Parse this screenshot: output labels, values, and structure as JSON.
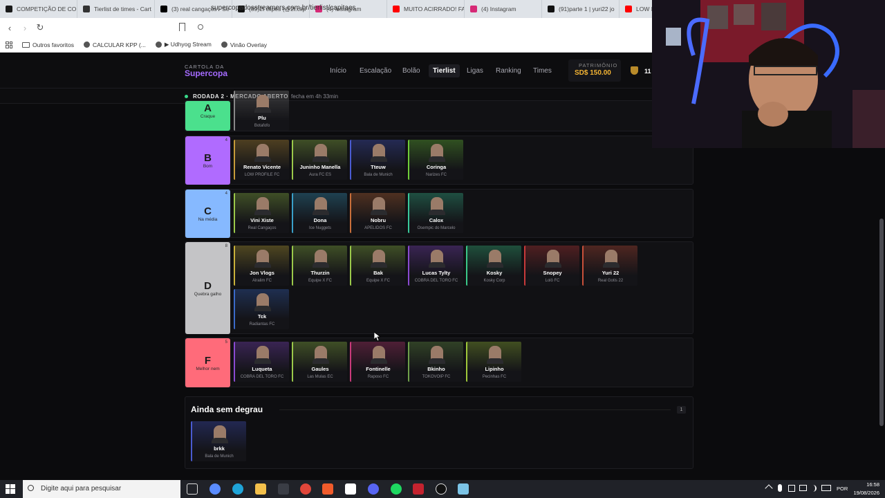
{
  "browser": {
    "tabs": [
      {
        "label": "COMPETIÇÃO DE COR",
        "color": "#1a1a1a"
      },
      {
        "label": "Tierlist de times - Cart",
        "color": "#333"
      },
      {
        "label": "(3) real cangaços - Se",
        "color": "#000"
      },
      {
        "label": "(89)2t clipes (@2t.clip",
        "color": "#111"
      },
      {
        "label": "(4) Instagram",
        "color": "#d62976"
      },
      {
        "label": "MUITO ACIRRADO! FA",
        "color": "#ff0000"
      },
      {
        "label": "(4) Instagram",
        "color": "#d62976"
      },
      {
        "label": "(91)parte 1 | yuri22 jo",
        "color": "#111"
      },
      {
        "label": "LOW P",
        "color": "#ff0000"
      }
    ],
    "url": "supercopadosstreamers.com.br/tierlist/capitaes",
    "bookmarks": [
      "Outros favoritos",
      "CALCULAR KPP (...",
      "▶ Udhyog Stream",
      "Vinão Overlay"
    ]
  },
  "site": {
    "logo_top": "CARTOLA DA",
    "logo_bottom": "Supercopa",
    "nav": [
      "Início",
      "Escalação",
      "Bolão",
      "Tierlist",
      "Ligas",
      "Ranking",
      "Times"
    ],
    "patrimonio_label": "PATRIMÔNIO",
    "patrimonio_value": "SD$ 150.00",
    "user_short": "11",
    "round_text": "RODADA 2 · MERCADO ABERTO",
    "round_close": "fecha em 4h  33min"
  },
  "tiers": [
    {
      "letter": "A",
      "desc": "Craque",
      "count": "",
      "color": "#4be08d",
      "cards": [
        {
          "name": "Plu",
          "team": "Botafofo",
          "accent": "#888888"
        }
      ]
    },
    {
      "letter": "B",
      "desc": "Bom",
      "count": "4",
      "color": "#b06bff",
      "cards": [
        {
          "name": "Renato Vicente",
          "team": "LOW PROFILE FC",
          "accent": "#c79b3a"
        },
        {
          "name": "Juninho Manella",
          "team": "Aura FC ES",
          "accent": "#9bc94a"
        },
        {
          "name": "Tteuw",
          "team": "Bala de Munich",
          "accent": "#4a5bd1"
        },
        {
          "name": "Coringa",
          "team": "Narizes FC",
          "accent": "#6fcf3a"
        }
      ]
    },
    {
      "letter": "C",
      "desc": "Na média",
      "count": "4",
      "color": "#86b9ff",
      "cards": [
        {
          "name": "Vini Xiste",
          "team": "Real Cangaços",
          "accent": "#9bc94a"
        },
        {
          "name": "Dona",
          "team": "Ice Nuggets",
          "accent": "#3aa0c9"
        },
        {
          "name": "Nobru",
          "team": "APELIDOS FC",
          "accent": "#c96f3a"
        },
        {
          "name": "Calox",
          "team": "Osempic do Marcelo",
          "accent": "#3ac99b"
        }
      ]
    },
    {
      "letter": "D",
      "desc": "Quebra galho",
      "count": "8",
      "color": "#c4c4c6",
      "cards": [
        {
          "name": "Jon Vlogs",
          "team": "Alralim FC",
          "accent": "#c9b13a"
        },
        {
          "name": "Thurzin",
          "team": "Equipe X FC",
          "accent": "#9bc94a"
        },
        {
          "name": "Bak",
          "team": "Equipe X FC",
          "accent": "#9bc94a"
        },
        {
          "name": "Lucas Tylty",
          "team": "COBRA DEL TORO FC",
          "accent": "#8a4ad1"
        },
        {
          "name": "Kosky",
          "team": "Kosky Corp",
          "accent": "#3ac98a"
        },
        {
          "name": "Snopey",
          "team": "Lolô FC",
          "accent": "#c93a3a"
        },
        {
          "name": "Yuri 22",
          "team": "Real Gotis 22",
          "accent": "#c9503a"
        },
        {
          "name": "Tck",
          "team": "Radiantas FC",
          "accent": "#3a6ac9"
        }
      ]
    },
    {
      "letter": "F",
      "desc": "Melhor nem",
      "count": "5",
      "color": "#ff6b7a",
      "cards": [
        {
          "name": "Luqueta",
          "team": "COBRA DEL TORO FC",
          "accent": "#8a4ad1"
        },
        {
          "name": "Gaules",
          "team": "Las Mulas EC",
          "accent": "#9bc94a"
        },
        {
          "name": "Fontinelle",
          "team": "Raposo FC",
          "accent": "#c93a7a"
        },
        {
          "name": "Bkinho",
          "team": "TOKOVOIP FC",
          "accent": "#6fa04a"
        },
        {
          "name": "Lipinho",
          "team": "Pecinhas FC",
          "accent": "#a0c93a"
        }
      ]
    }
  ],
  "unranked": {
    "title": "Ainda sem degrau",
    "count": "1",
    "cards": [
      {
        "name": "brkk",
        "team": "Bala de Munich",
        "accent": "#4a5bd1"
      }
    ]
  },
  "taskbar": {
    "search_placeholder": "Digite aqui para pesquisar",
    "language": "POR",
    "time": "16:58",
    "date": "19/08/2026"
  }
}
